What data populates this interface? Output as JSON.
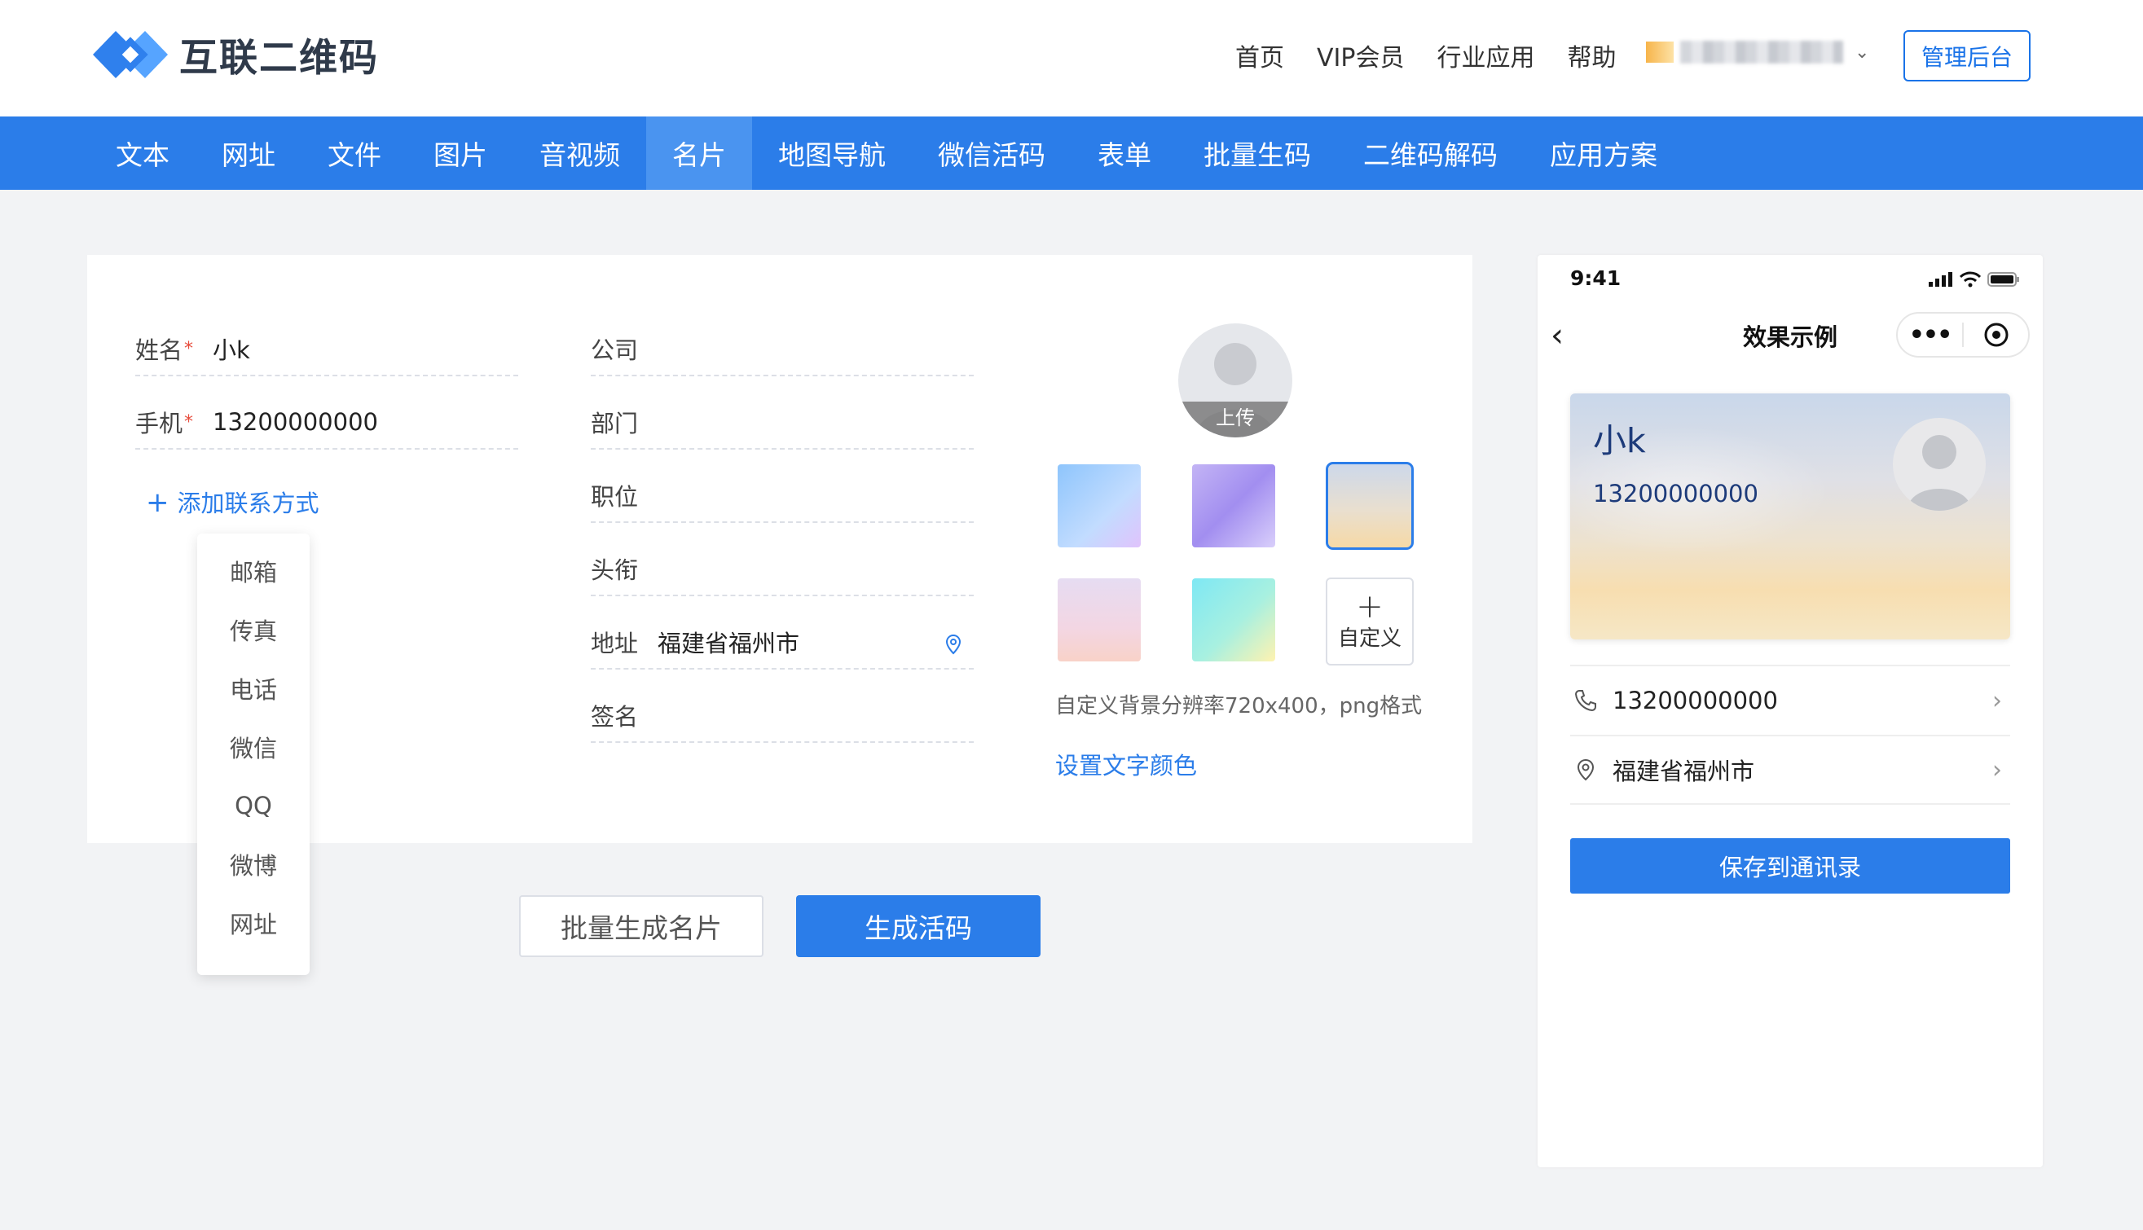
{
  "brand": {
    "name": "互联二维码",
    "accent": "#2b7de9"
  },
  "topnav": {
    "items": [
      "首页",
      "VIP会员",
      "行业应用",
      "帮助"
    ],
    "admin_label": "管理后台"
  },
  "tabs": [
    "文本",
    "网址",
    "文件",
    "图片",
    "音视频",
    "名片",
    "地图导航",
    "微信活码",
    "表单",
    "批量生码",
    "二维码解码",
    "应用方案"
  ],
  "active_tab": "名片",
  "form": {
    "name": {
      "label": "姓名",
      "required_mark": "*",
      "value": "小k"
    },
    "mobile": {
      "label": "手机",
      "required_mark": "*",
      "value": "13200000000"
    },
    "add_contact": {
      "icon": "+",
      "label": "添加联系方式"
    },
    "contact_options": [
      "邮箱",
      "传真",
      "电话",
      "微信",
      "QQ",
      "微博",
      "网址"
    ],
    "company": {
      "label": "公司",
      "value": ""
    },
    "department": {
      "label": "部门",
      "value": ""
    },
    "position": {
      "label": "职位",
      "value": ""
    },
    "title": {
      "label": "头衔",
      "value": ""
    },
    "address": {
      "label": "地址",
      "value": "福建省福州市"
    },
    "signature": {
      "label": "签名",
      "value": ""
    }
  },
  "style_panel": {
    "upload_label": "上传",
    "custom_icon": "+",
    "custom_label": "自定义",
    "hint": "自定义背景分辨率720x400，png格式",
    "text_color_link": "设置文字颜色"
  },
  "actions": {
    "batch_label": "批量生成名片",
    "generate_label": "生成活码"
  },
  "preview": {
    "time": "9:41",
    "title": "效果示例",
    "card_name": "小k",
    "card_phone": "13200000000",
    "rows": [
      {
        "icon": "phone-icon",
        "text": "13200000000"
      },
      {
        "icon": "location-icon",
        "text": "福建省福州市"
      }
    ],
    "save_label": "保存到通讯录"
  }
}
